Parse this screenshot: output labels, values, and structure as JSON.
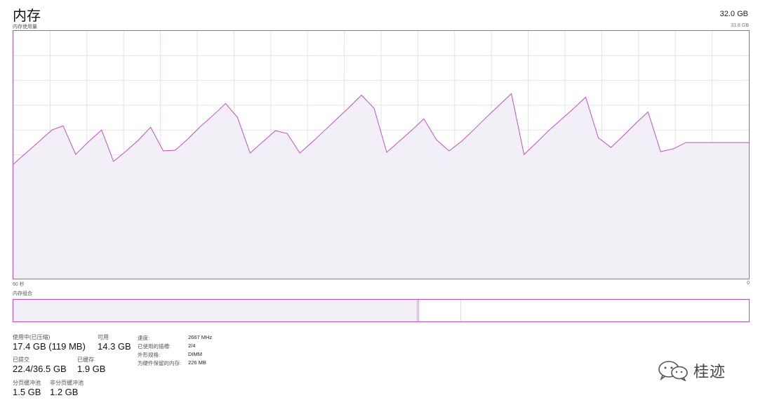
{
  "header": {
    "title": "内存",
    "total": "32.0 GB"
  },
  "graph": {
    "usage_label": "内存使用量",
    "max_label": "31.8 GB",
    "time_left": "60 秒",
    "time_right": "0",
    "line_color": "#c050c8",
    "fill_color": "#f3eff6",
    "grid_color": "#e8e0ea"
  },
  "composition": {
    "label": "内存组合"
  },
  "stats": {
    "in_use_label": "使用中(已压缩)",
    "in_use_value": "17.4 GB (119 MB)",
    "available_label": "可用",
    "available_value": "14.3 GB",
    "committed_label": "已提交",
    "committed_value": "22.4/36.5 GB",
    "cached_label": "已缓存",
    "cached_value": "1.9 GB",
    "paged_pool_label": "分页缓冲池",
    "paged_pool_value": "1.5 GB",
    "nonpaged_pool_label": "非分页缓冲池",
    "nonpaged_pool_value": "1.2 GB"
  },
  "details": {
    "speed_label": "速度:",
    "speed_value": "2667 MHz",
    "slots_label": "已使用的插槽:",
    "slots_value": "2/4",
    "form_label": "外形规格:",
    "form_value": "DIMM",
    "reserved_label": "为硬件保留的内存:",
    "reserved_value": "226 MB"
  },
  "watermark": {
    "text": "桂迹",
    "icon": "wechat-icon"
  }
}
